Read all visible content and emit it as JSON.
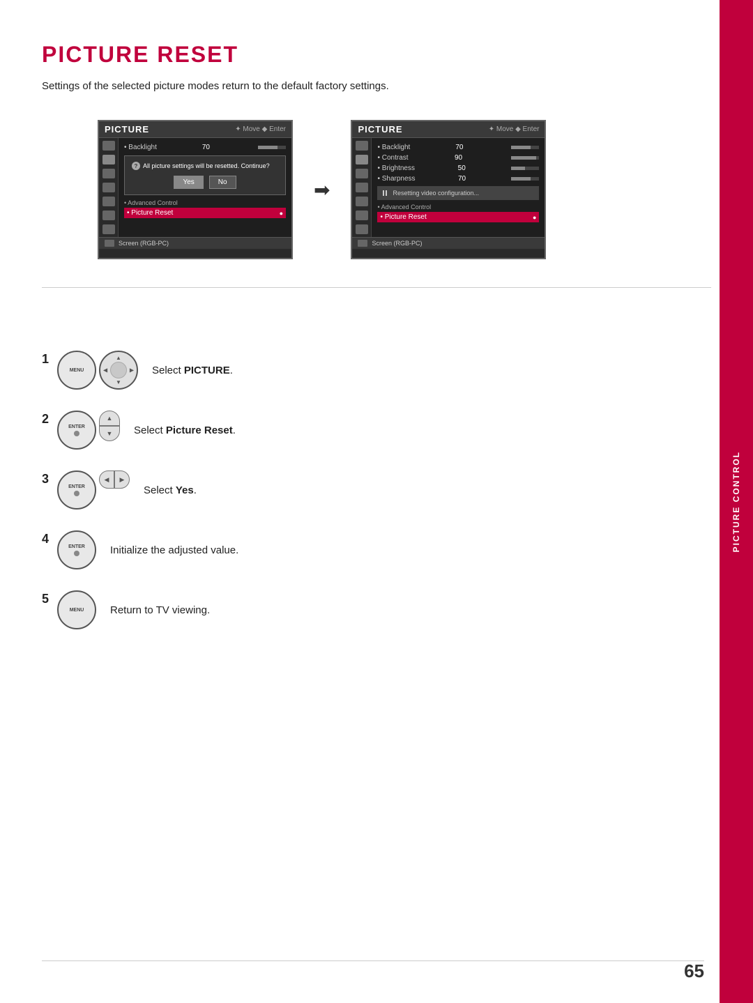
{
  "page": {
    "title": "PICTURE RESET",
    "subtitle": "Settings of the selected picture modes return to the default factory settings.",
    "page_number": "65",
    "sidebar_label": "PICTURE CONTROL"
  },
  "screens": {
    "before": {
      "header_title": "PICTURE",
      "nav_hint": "Move  Enter",
      "menu_item_backlight": "• Backlight",
      "backlight_value": "70",
      "dialog_text": "All picture settings will be resetted. Continue?",
      "btn_yes": "Yes",
      "btn_no": "No",
      "advanced_control": "• Advanced Control",
      "picture_reset": "• Picture Reset",
      "footer_text": "Screen (RGB-PC)"
    },
    "after": {
      "header_title": "PICTURE",
      "nav_hint": "Move  Enter",
      "menu_item_backlight": "• Backlight",
      "backlight_value": "70",
      "menu_item_contrast": "• Contrast",
      "contrast_value": "90",
      "menu_item_brightness": "• Brightness",
      "brightness_value": "50",
      "menu_item_sharpness": "• Sharpness",
      "sharpness_value": "70",
      "resetting_text": "Resetting video configuration...",
      "advanced_control": "• Advanced Control",
      "picture_reset": "• Picture Reset",
      "footer_text": "Screen (RGB-PC)"
    }
  },
  "steps": [
    {
      "number": "1",
      "buttons": [
        "menu",
        "nav-wheel"
      ],
      "text": "Select ",
      "bold_text": "PICTURE",
      "text_after": "."
    },
    {
      "number": "2",
      "buttons": [
        "enter",
        "updown"
      ],
      "text": "Select ",
      "bold_text": "Picture Reset",
      "text_after": "."
    },
    {
      "number": "3",
      "buttons": [
        "enter",
        "leftright"
      ],
      "text": "Select ",
      "bold_text": "Yes",
      "text_after": "."
    },
    {
      "number": "4",
      "buttons": [
        "enter"
      ],
      "text": "Initialize the adjusted value.",
      "bold_text": "",
      "text_after": ""
    },
    {
      "number": "5",
      "buttons": [
        "menu"
      ],
      "text": "Return to TV viewing.",
      "bold_text": "",
      "text_after": ""
    }
  ]
}
